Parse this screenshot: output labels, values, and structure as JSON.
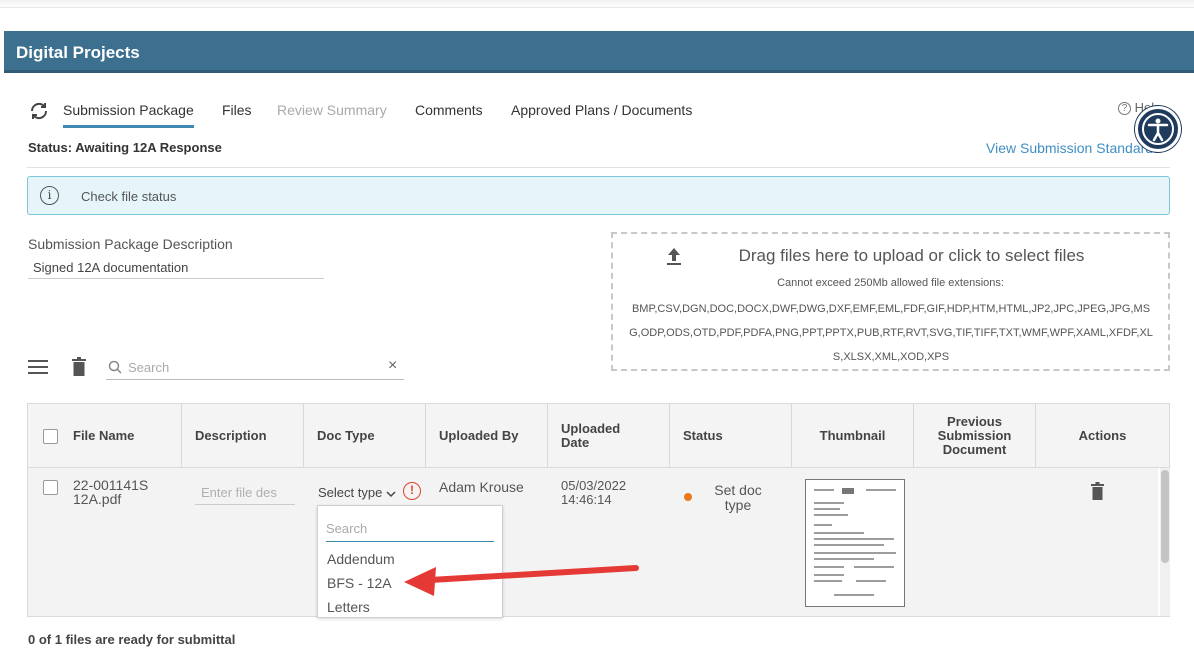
{
  "app": {
    "title": "Digital Projects"
  },
  "tabs": [
    {
      "label": "Submission Package"
    },
    {
      "label": "Files"
    },
    {
      "label": "Review Summary"
    },
    {
      "label": "Comments"
    },
    {
      "label": "Approved Plans / Documents"
    }
  ],
  "help": {
    "label": "Help"
  },
  "status": {
    "text": "Status: Awaiting 12A Response"
  },
  "links": {
    "standards": "View Submission Standards"
  },
  "info": {
    "text": "Check file status"
  },
  "description": {
    "label": "Submission Package Description",
    "value": "Signed 12A documentation"
  },
  "upload": {
    "title": "Drag files here to upload or click to select files",
    "limit": "Cannot exceed 250Mb allowed file extensions:",
    "extensions": "BMP,CSV,DGN,DOC,DOCX,DWF,DWG,DXF,EMF,EML,FDF,GIF,HDP,HTM,HTML,JP2,JPC,JPEG,JPG,MSG,ODP,ODS,OTD,PDF,PDFA,PNG,PPT,PPTX,PUB,RTF,RVT,SVG,TIF,TIFF,TXT,WMF,WPF,XAML,XFDF,XLS,XLSX,XML,XOD,XPS"
  },
  "search": {
    "placeholder": "Search",
    "clear": "×"
  },
  "table": {
    "headers": {
      "file_name": "File Name",
      "description": "Description",
      "doc_type": "Doc Type",
      "uploaded_by": "Uploaded By",
      "uploaded_date": "Uploaded Date",
      "status": "Status",
      "thumbnail": "Thumbnail",
      "previous": "Previous Submission Document",
      "actions": "Actions"
    },
    "rows": [
      {
        "file_name": "22-001141S 12A.pdf",
        "description_placeholder": "Enter file des",
        "doc_type": "Select type",
        "uploaded_by": "Adam Krouse",
        "uploaded_date": "05/03/2022 14:46:14",
        "status": "Set doc type"
      }
    ]
  },
  "dropdown": {
    "search_placeholder": "Search",
    "options": [
      "Addendum",
      "BFS - 12A",
      "Letters"
    ]
  },
  "footer": {
    "text": "0 of 1 files are ready for submittal"
  },
  "colors": {
    "header": "#3d6f8f",
    "accent": "#3f89b0",
    "link": "#3f8fc3",
    "status_dot": "#e87a1b",
    "warning": "#e0422d",
    "arrow": "#e53935"
  },
  "icons": [
    "sync-icon",
    "help-icon",
    "accessibility-icon",
    "info-icon",
    "upload-icon",
    "menu-icon",
    "trash-icon",
    "search-icon",
    "close-icon",
    "checkbox-icon",
    "chevron-down-icon",
    "warning-icon"
  ]
}
